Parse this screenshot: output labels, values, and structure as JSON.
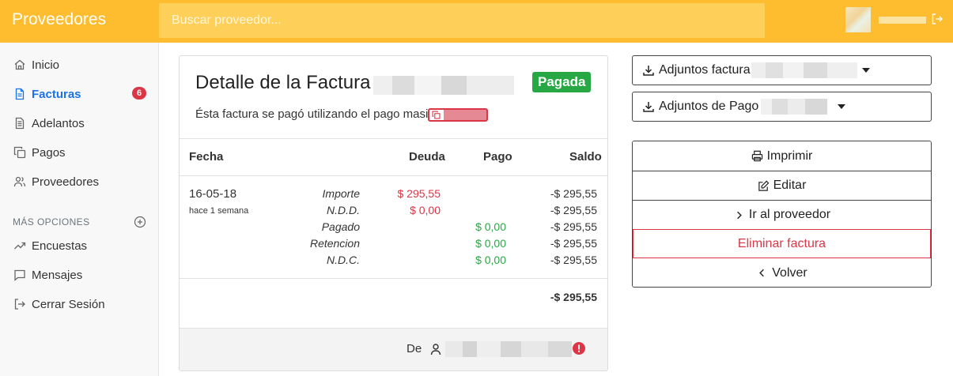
{
  "app": {
    "brand": "Proveedores",
    "search_placeholder": "Buscar proveedor..."
  },
  "sidebar": {
    "items": [
      {
        "label": "Inicio",
        "icon": "home-icon"
      },
      {
        "label": "Facturas",
        "icon": "file-icon",
        "active": true,
        "badge": "6"
      },
      {
        "label": "Adelantos",
        "icon": "document-icon"
      },
      {
        "label": "Pagos",
        "icon": "copy-icon"
      },
      {
        "label": "Proveedores",
        "icon": "users-icon"
      }
    ],
    "section_title": "MÁS OPCIONES",
    "more": [
      {
        "label": "Encuestas",
        "icon": "trending-icon"
      },
      {
        "label": "Mensajes",
        "icon": "message-icon"
      },
      {
        "label": "Cerrar Sesión",
        "icon": "logout-icon"
      }
    ]
  },
  "invoice": {
    "title": "Detalle de la Factura",
    "status": "Pagada",
    "mass_payment_note": "Ésta factura se pagó utilizando el pago masivo",
    "headers": {
      "date": "Fecha",
      "debt": "Deuda",
      "payment": "Pago",
      "balance": "Saldo"
    },
    "date": "16-05-18",
    "date_relative": "hace 1 semana",
    "rows": [
      {
        "label": "Importe",
        "debt": "$ 295,55",
        "payment": "",
        "balance": "-$ 295,55"
      },
      {
        "label": "N.D.D.",
        "debt": "$ 0,00",
        "payment": "",
        "balance": "-$ 295,55"
      },
      {
        "label": "Pagado",
        "debt": "",
        "payment": "$ 0,00",
        "balance": "-$ 295,55"
      },
      {
        "label": "Retencion",
        "debt": "",
        "payment": "$ 0,00",
        "balance": "-$ 295,55"
      },
      {
        "label": "N.D.C.",
        "debt": "",
        "payment": "$ 0,00",
        "balance": "-$ 295,55"
      }
    ],
    "total": "-$ 295,55",
    "from_label": "De"
  },
  "panel": {
    "attachments_invoice": "Adjuntos factura",
    "attachments_payment": "Adjuntos de Pago",
    "actions": {
      "print": "Imprimir",
      "edit": "Editar",
      "go_to_supplier": "Ir al proveedor",
      "delete": "Eliminar factura",
      "back": "Volver"
    }
  },
  "colors": {
    "topbar": "#fdbd2e",
    "active_nav": "#1a73e8",
    "success": "#28a745",
    "danger": "#dc3545"
  }
}
